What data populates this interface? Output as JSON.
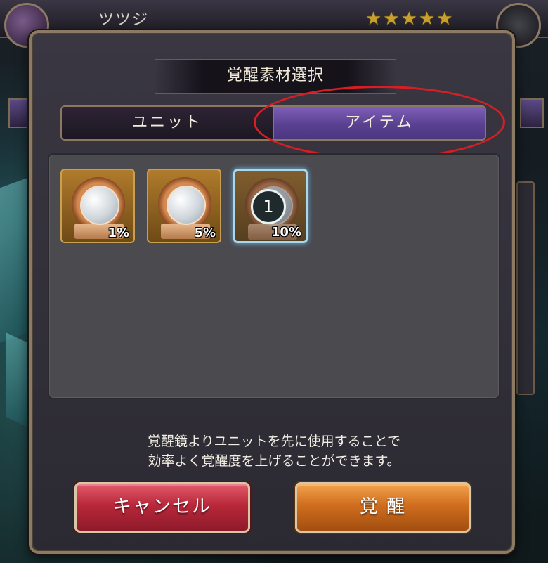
{
  "background": {
    "unit_name": "ツツジ",
    "rarity_stars": "★★★★★"
  },
  "dialog": {
    "title": "覚醒素材選択",
    "tabs": [
      {
        "label": "ユニット",
        "active": false
      },
      {
        "label": "アイテム",
        "active": true
      }
    ],
    "items": [
      {
        "icon": "awakening-mirror-icon",
        "percent": "1%",
        "selected": false
      },
      {
        "icon": "awakening-mirror-icon",
        "percent": "5%",
        "selected": false
      },
      {
        "icon": "awakening-mirror-icon",
        "percent": "10%",
        "selected": true,
        "count": "1"
      }
    ],
    "message_line1": "覚醒鏡よりユニットを先に使用することで",
    "message_line2": "効率よく覚醒度を上げることができます。",
    "buttons": {
      "cancel": "キャンセル",
      "awaken": "覚 醒"
    }
  },
  "colors": {
    "active_tab": "#5a4190",
    "cancel_button": "#b8283a",
    "awaken_button": "#cf6e1e",
    "annotation_circle": "#d81e25"
  }
}
